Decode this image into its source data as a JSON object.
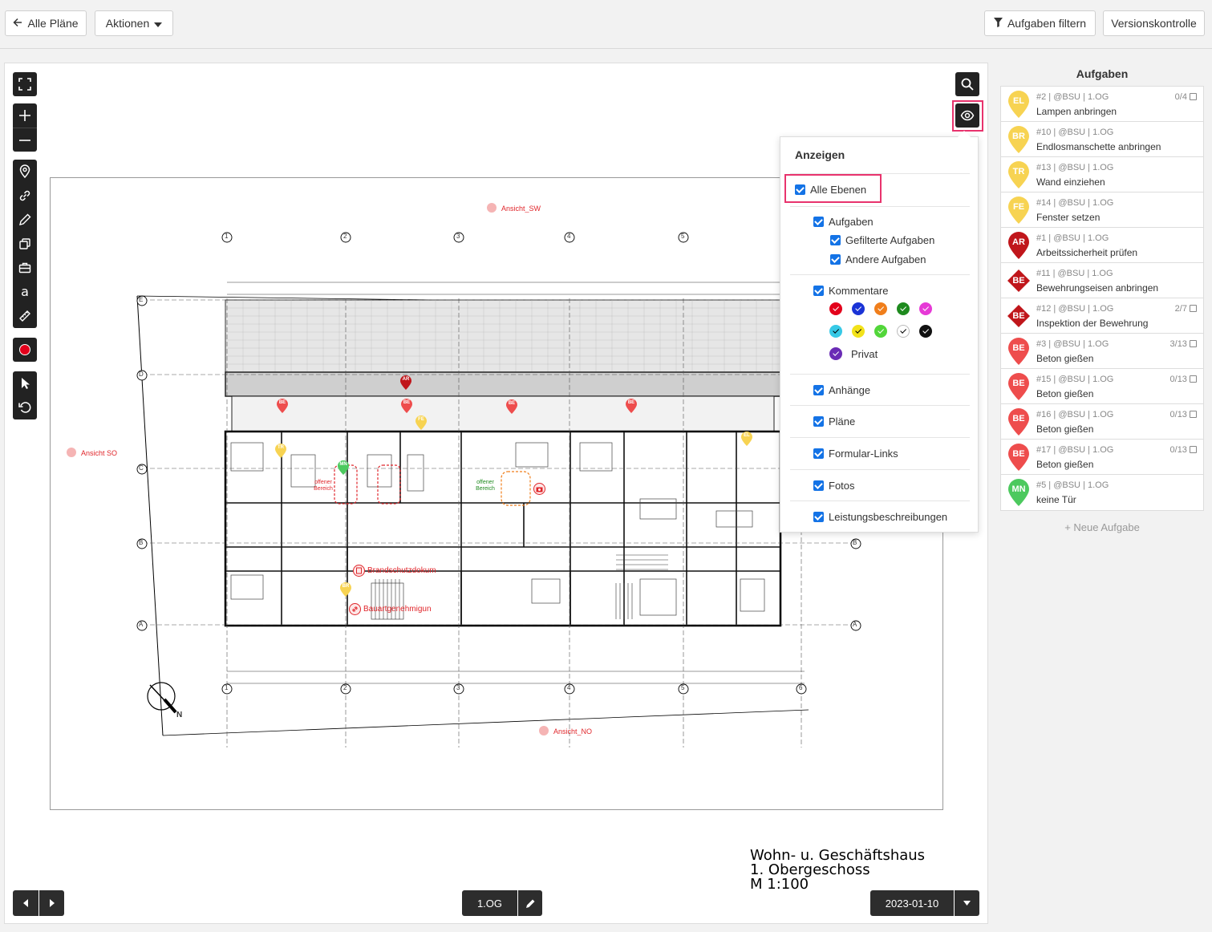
{
  "toolbar": {
    "back_label": "Alle Pläne",
    "actions_label": "Aktionen",
    "filter_label": "Aufgaben filtern",
    "version_label": "Versionskontrolle"
  },
  "panel": {
    "title": "Anzeigen",
    "all_layers": "Alle Ebenen",
    "tasks": "Aufgaben",
    "filtered_tasks": "Gefilterte Aufgaben",
    "other_tasks": "Andere Aufgaben",
    "comments": "Kommentare",
    "comment_colors": [
      "#e3001b",
      "#1a33d6",
      "#f07e1b",
      "#1e8a1e",
      "#e639d6",
      "#37c9e6",
      "#f2e21a",
      "#52d63a",
      "#ffffff",
      "#111111"
    ],
    "private": "Privat",
    "private_color": "#6a2bb5",
    "attachments": "Anhänge",
    "plans": "Pläne",
    "form_links": "Formular-Links",
    "photos": "Fotos",
    "service_descriptions": "Leistungsbeschreibungen"
  },
  "sidebar": {
    "title": "Aufgaben",
    "new_task": "+ Neue Aufgabe",
    "tasks": [
      {
        "initials": "EL",
        "meta": "#2 | @BSU | 1.OG",
        "name": "Lampen anbringen",
        "count": "0/4",
        "color": "#f7d352",
        "shape": "pin"
      },
      {
        "initials": "BR",
        "meta": "#10 | @BSU | 1.OG",
        "name": "Endlosmanschette anbringen",
        "count": "",
        "color": "#f7d352",
        "shape": "pin"
      },
      {
        "initials": "TR",
        "meta": "#13 | @BSU | 1.OG",
        "name": "Wand einziehen",
        "count": "",
        "color": "#f7d352",
        "shape": "pin"
      },
      {
        "initials": "FE",
        "meta": "#14 | @BSU | 1.OG",
        "name": "Fenster setzen",
        "count": "",
        "color": "#f7d352",
        "shape": "pin"
      },
      {
        "initials": "AR",
        "meta": "#1 | @BSU | 1.OG",
        "name": "Arbeitssicherheit prüfen",
        "count": "",
        "color": "#c0161b",
        "shape": "pin"
      },
      {
        "initials": "BE",
        "meta": "#11 | @BSU | 1.OG",
        "name": "Bewehrungseisen anbringen",
        "count": "",
        "color": "#c0161b",
        "shape": "diamond"
      },
      {
        "initials": "BE",
        "meta": "#12 | @BSU | 1.OG",
        "name": "Inspektion der Bewehrung",
        "count": "2/7",
        "color": "#c0161b",
        "shape": "diamond"
      },
      {
        "initials": "BE",
        "meta": "#3 | @BSU | 1.OG",
        "name": "Beton gießen",
        "count": "3/13",
        "color": "#ee4d4d",
        "shape": "pin"
      },
      {
        "initials": "BE",
        "meta": "#15 | @BSU | 1.OG",
        "name": "Beton gießen",
        "count": "0/13",
        "color": "#ee4d4d",
        "shape": "pin"
      },
      {
        "initials": "BE",
        "meta": "#16 | @BSU | 1.OG",
        "name": "Beton gießen",
        "count": "0/13",
        "color": "#ee4d4d",
        "shape": "pin"
      },
      {
        "initials": "BE",
        "meta": "#17 | @BSU | 1.OG",
        "name": "Beton gießen",
        "count": "0/13",
        "color": "#ee4d4d",
        "shape": "pin"
      },
      {
        "initials": "MN",
        "meta": "#5 | @BSU | 1.OG",
        "name": "keine Tür",
        "count": "",
        "color": "#4cc95e",
        "shape": "pin"
      }
    ]
  },
  "plan": {
    "view_sw": "Ansicht_SW",
    "view_so": "Ansicht SO",
    "view_no": "Ansicht_NO",
    "fire_doc": "Brandschutzdokum",
    "permit": "Bauartgenehmigun",
    "open_area": "offener Bereich",
    "north": "N",
    "title_line1": "Wohn- u. Geschäftshaus",
    "title_line2": "1. Obergeschoss",
    "title_line3": "M 1:100",
    "grid_numbers": [
      "1",
      "2",
      "3",
      "4",
      "5",
      "6"
    ],
    "grid_letters": [
      "E",
      "D",
      "C",
      "B",
      "A"
    ],
    "pins": [
      {
        "initials": "AR",
        "color": "#c0161b"
      },
      {
        "initials": "BE",
        "color": "#ee4d4d"
      },
      {
        "initials": "BE",
        "color": "#ee4d4d"
      },
      {
        "initials": "BE",
        "color": "#ee4d4d"
      },
      {
        "initials": "BE",
        "color": "#ee4d4d"
      },
      {
        "initials": "FE",
        "color": "#f7d352"
      },
      {
        "initials": "TR",
        "color": "#f7d352"
      },
      {
        "initials": "EL",
        "color": "#f7d352"
      },
      {
        "initials": "MN",
        "color": "#4cc95e"
      },
      {
        "initials": "BR",
        "color": "#f7d352"
      }
    ]
  },
  "bottom": {
    "floor": "1.OG",
    "date": "2023-01-10"
  }
}
